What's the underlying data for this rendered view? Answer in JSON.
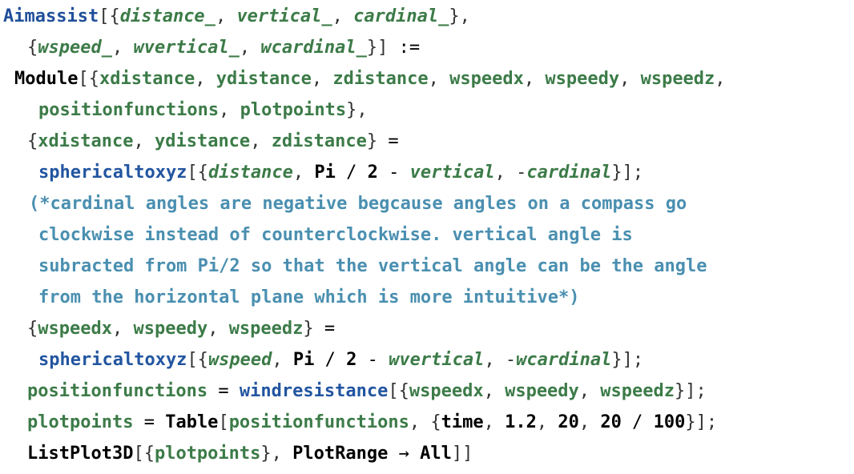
{
  "code": {
    "lines": [
      [
        {
          "t": "Aimassist",
          "c": "def"
        },
        {
          "t": "[{",
          "c": "punc"
        },
        {
          "t": "distance_",
          "c": "pat"
        },
        {
          "t": ", ",
          "c": "punc"
        },
        {
          "t": "vertical_",
          "c": "pat"
        },
        {
          "t": ", ",
          "c": "punc"
        },
        {
          "t": "cardinal_",
          "c": "pat"
        },
        {
          "t": "},",
          "c": "punc"
        }
      ],
      [
        {
          "t": "{",
          "c": "punc"
        },
        {
          "t": "wspeed_",
          "c": "pat"
        },
        {
          "t": ", ",
          "c": "punc"
        },
        {
          "t": "wvertical_",
          "c": "pat"
        },
        {
          "t": ", ",
          "c": "punc"
        },
        {
          "t": "wcardinal_",
          "c": "pat"
        },
        {
          "t": "}] ",
          "c": "punc"
        },
        {
          "t": ":=",
          "c": "op"
        }
      ],
      [
        {
          "t": "Module",
          "c": "blt"
        },
        {
          "t": "[{",
          "c": "punc"
        },
        {
          "t": "xdistance",
          "c": "var"
        },
        {
          "t": ", ",
          "c": "punc"
        },
        {
          "t": "ydistance",
          "c": "var"
        },
        {
          "t": ", ",
          "c": "punc"
        },
        {
          "t": "zdistance",
          "c": "var"
        },
        {
          "t": ", ",
          "c": "punc"
        },
        {
          "t": "wspeedx",
          "c": "var"
        },
        {
          "t": ", ",
          "c": "punc"
        },
        {
          "t": "wspeedy",
          "c": "var"
        },
        {
          "t": ", ",
          "c": "punc"
        },
        {
          "t": "wspeedz",
          "c": "var"
        },
        {
          "t": ",",
          "c": "punc"
        }
      ],
      [
        {
          "t": "positionfunctions",
          "c": "var"
        },
        {
          "t": ", ",
          "c": "punc"
        },
        {
          "t": "plotpoints",
          "c": "var"
        },
        {
          "t": "},",
          "c": "punc"
        }
      ],
      [
        {
          "t": "{",
          "c": "punc"
        },
        {
          "t": "xdistance",
          "c": "var"
        },
        {
          "t": ", ",
          "c": "punc"
        },
        {
          "t": "ydistance",
          "c": "var"
        },
        {
          "t": ", ",
          "c": "punc"
        },
        {
          "t": "zdistance",
          "c": "var"
        },
        {
          "t": "} ",
          "c": "punc"
        },
        {
          "t": "=",
          "c": "op"
        }
      ],
      [
        {
          "t": "sphericaltoxyz",
          "c": "fn"
        },
        {
          "t": "[{",
          "c": "punc"
        },
        {
          "t": "distance",
          "c": "pat"
        },
        {
          "t": ", ",
          "c": "punc"
        },
        {
          "t": "Pi",
          "c": "blt"
        },
        {
          "t": " / ",
          "c": "op"
        },
        {
          "t": "2",
          "c": "num"
        },
        {
          "t": " - ",
          "c": "op"
        },
        {
          "t": "vertical",
          "c": "pat"
        },
        {
          "t": ", -",
          "c": "punc"
        },
        {
          "t": "cardinal",
          "c": "pat"
        },
        {
          "t": "}];",
          "c": "punc"
        }
      ],
      [
        {
          "t": "(*cardinal angles are negative begcause angles on a compass go",
          "c": "cmt"
        }
      ],
      [
        {
          "t": "clockwise instead of counterclockwise. vertical angle is",
          "c": "cmt"
        }
      ],
      [
        {
          "t": "subracted from Pi/2 so that the vertical angle can be the angle",
          "c": "cmt"
        }
      ],
      [
        {
          "t": "from the horizontal plane which is more intuitive*)",
          "c": "cmt"
        }
      ],
      [
        {
          "t": "{",
          "c": "punc"
        },
        {
          "t": "wspeedx",
          "c": "var"
        },
        {
          "t": ", ",
          "c": "punc"
        },
        {
          "t": "wspeedy",
          "c": "var"
        },
        {
          "t": ", ",
          "c": "punc"
        },
        {
          "t": "wspeedz",
          "c": "var"
        },
        {
          "t": "} ",
          "c": "punc"
        },
        {
          "t": "=",
          "c": "op"
        }
      ],
      [
        {
          "t": "sphericaltoxyz",
          "c": "fn"
        },
        {
          "t": "[{",
          "c": "punc"
        },
        {
          "t": "wspeed",
          "c": "pat"
        },
        {
          "t": ", ",
          "c": "punc"
        },
        {
          "t": "Pi",
          "c": "blt"
        },
        {
          "t": " / ",
          "c": "op"
        },
        {
          "t": "2",
          "c": "num"
        },
        {
          "t": " - ",
          "c": "op"
        },
        {
          "t": "wvertical",
          "c": "pat"
        },
        {
          "t": ", -",
          "c": "punc"
        },
        {
          "t": "wcardinal",
          "c": "pat"
        },
        {
          "t": "}];",
          "c": "punc"
        }
      ],
      [
        {
          "t": "positionfunctions",
          "c": "var"
        },
        {
          "t": " = ",
          "c": "op"
        },
        {
          "t": "windresistance",
          "c": "fn"
        },
        {
          "t": "[{",
          "c": "punc"
        },
        {
          "t": "wspeedx",
          "c": "var"
        },
        {
          "t": ", ",
          "c": "punc"
        },
        {
          "t": "wspeedy",
          "c": "var"
        },
        {
          "t": ", ",
          "c": "punc"
        },
        {
          "t": "wspeedz",
          "c": "var"
        },
        {
          "t": "}];",
          "c": "punc"
        }
      ],
      [
        {
          "t": "plotpoints",
          "c": "var"
        },
        {
          "t": " = ",
          "c": "op"
        },
        {
          "t": "Table",
          "c": "blt"
        },
        {
          "t": "[",
          "c": "punc"
        },
        {
          "t": "positionfunctions",
          "c": "var"
        },
        {
          "t": ", {",
          "c": "punc"
        },
        {
          "t": "time",
          "c": "blt"
        },
        {
          "t": ", ",
          "c": "punc"
        },
        {
          "t": "1.2",
          "c": "num"
        },
        {
          "t": ", ",
          "c": "punc"
        },
        {
          "t": "20",
          "c": "num"
        },
        {
          "t": ", ",
          "c": "punc"
        },
        {
          "t": "20",
          "c": "num"
        },
        {
          "t": " / ",
          "c": "op"
        },
        {
          "t": "100",
          "c": "num"
        },
        {
          "t": "}];",
          "c": "punc"
        }
      ],
      [
        {
          "t": "ListPlot3D",
          "c": "blt"
        },
        {
          "t": "[{",
          "c": "punc"
        },
        {
          "t": "plotpoints",
          "c": "var"
        },
        {
          "t": "}, ",
          "c": "punc"
        },
        {
          "t": "PlotRange",
          "c": "blt"
        },
        {
          "t": " → ",
          "c": "op"
        },
        {
          "t": "All",
          "c": "blt"
        },
        {
          "t": "]]",
          "c": "punc"
        }
      ]
    ]
  }
}
